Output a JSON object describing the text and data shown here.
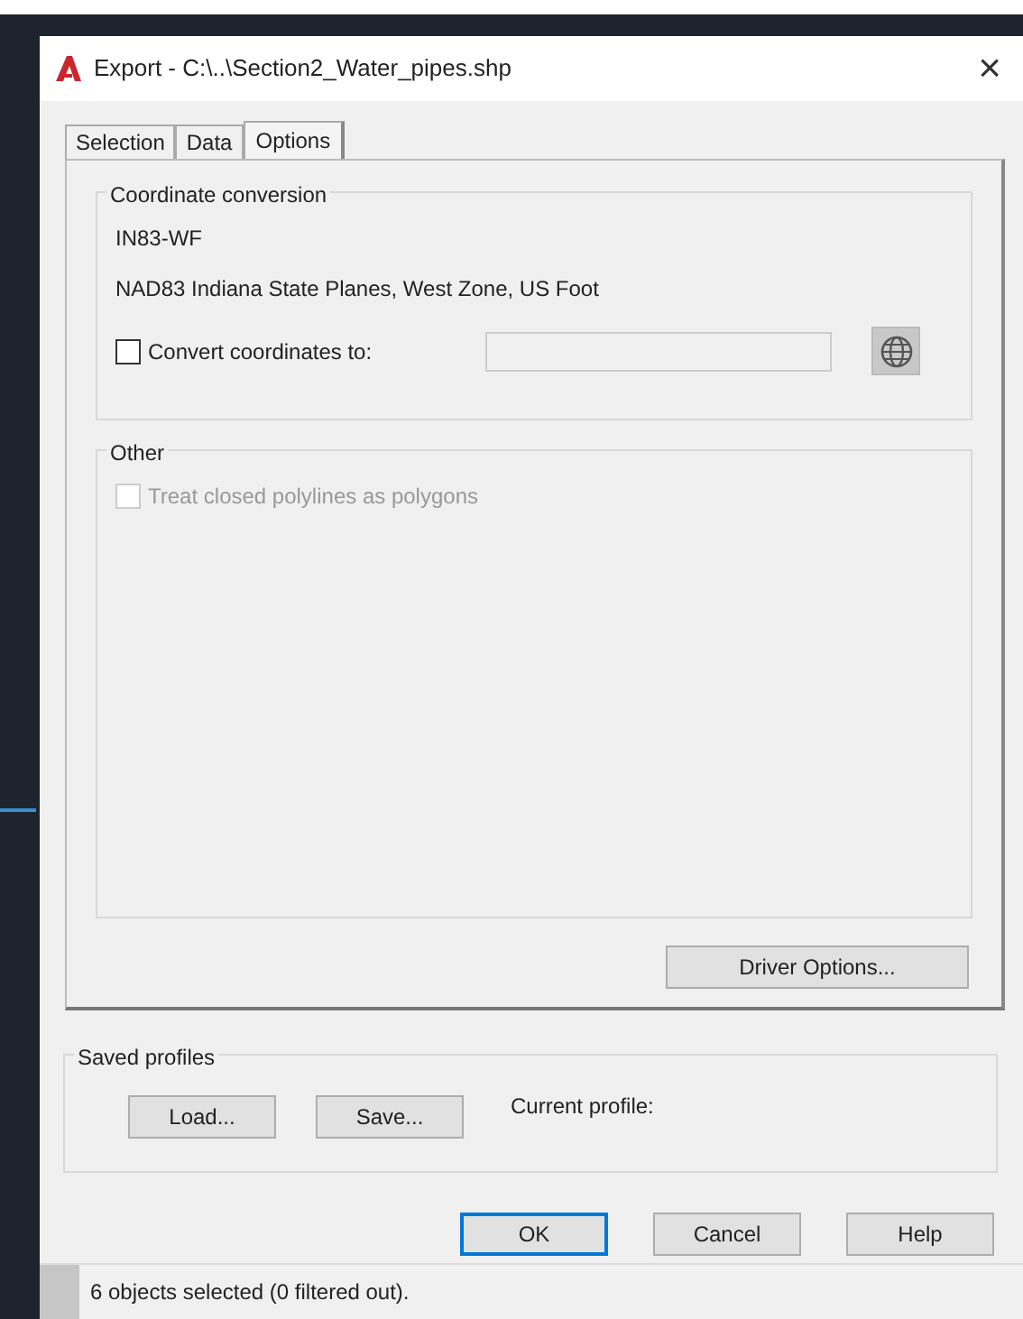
{
  "window": {
    "title": "Export - C:\\..\\Section2_Water_pipes.shp",
    "close": "×"
  },
  "tabs": [
    {
      "label": "Selection",
      "selected": false
    },
    {
      "label": "Data",
      "selected": false
    },
    {
      "label": "Options",
      "selected": true
    }
  ],
  "coordinate_conversion": {
    "title": "Coordinate conversion",
    "code": "IN83-WF",
    "description": "NAD83 Indiana State Planes, West Zone, US Foot",
    "convert": {
      "label": "Convert coordinates to:",
      "checked": false,
      "disabled": false
    }
  },
  "other": {
    "title": "Other",
    "treat_closed": {
      "label": "Treat closed polylines as polygons",
      "checked": false,
      "disabled": true
    }
  },
  "driver_options": "Driver Options...",
  "saved_profiles": {
    "title": "Saved profiles",
    "buttons": [
      "Load...",
      "Save..."
    ],
    "current_profile_label": "Current profile:"
  },
  "buttons": [
    {
      "label": "OK",
      "default": true
    },
    {
      "label": "Cancel",
      "default": false
    },
    {
      "label": "Help",
      "default": false
    }
  ],
  "status_bar": "6 objects selected (0 filtered out)."
}
